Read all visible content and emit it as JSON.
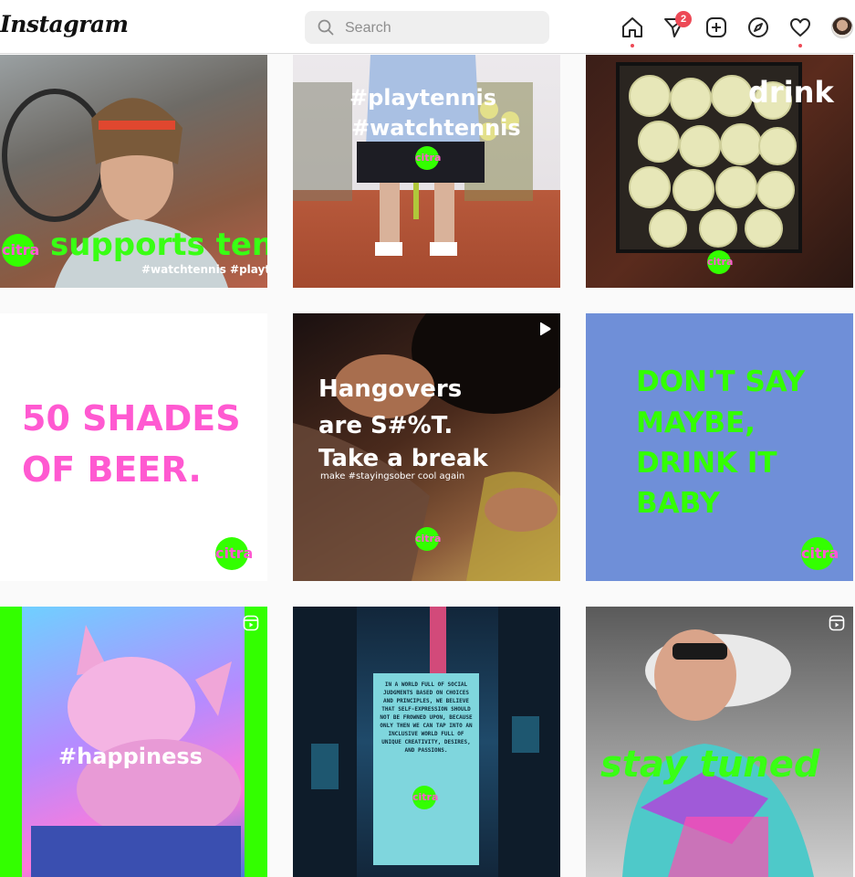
{
  "header": {
    "logo": "Instagram",
    "search_placeholder": "Search",
    "notification_count": "2",
    "icons": [
      "home-icon",
      "direct-icon",
      "new-post-icon",
      "explore-icon",
      "activity-icon",
      "profile-avatar"
    ],
    "colors": {
      "badge": "#ed4956",
      "brand_green": "#33ff00",
      "brand_pink": "#ff59d1"
    }
  },
  "posts": [
    {
      "id": "tile-1",
      "overlay": "supports tennis",
      "hashtags": "#watchtennis #playtennis",
      "brand": "citra"
    },
    {
      "id": "tile-2",
      "line1": "#playtennis",
      "line2": "#watchtennis",
      "brand": "citra"
    },
    {
      "id": "tile-3",
      "overlay": "drink",
      "brand": "citra"
    },
    {
      "id": "tile-4",
      "line1": "50 SHADES",
      "line2": "OF BEER.",
      "brand": "citra"
    },
    {
      "id": "tile-5",
      "line1": "Hangovers",
      "line2": "are S#%T.",
      "line3": "Take a break",
      "caption": "make #stayingsober cool again",
      "brand": "citra",
      "media": "video"
    },
    {
      "id": "tile-6",
      "line1": "DON'T SAY",
      "line2": "MAYBE,",
      "line3": "DRINK IT",
      "line4": "BABY",
      "brand": "citra"
    },
    {
      "id": "tile-7",
      "overlay": "#happiness",
      "media": "reel"
    },
    {
      "id": "tile-8",
      "sign": "IN A WORLD FULL OF SOCIAL JUDGMENTS BASED ON CHOICES AND PRINCIPLES, WE BELIEVE THAT SELF-EXPRESSION SHOULD NOT BE FROWNED UPON, BECAUSE ONLY THEN WE CAN TAP INTO AN INCLUSIVE WORLD FULL OF UNIQUE CREATIVITY, DESIRES, AND PASSIONS.",
      "brand": "citra"
    },
    {
      "id": "tile-9",
      "overlay": "stay tuned",
      "media": "reel"
    }
  ]
}
